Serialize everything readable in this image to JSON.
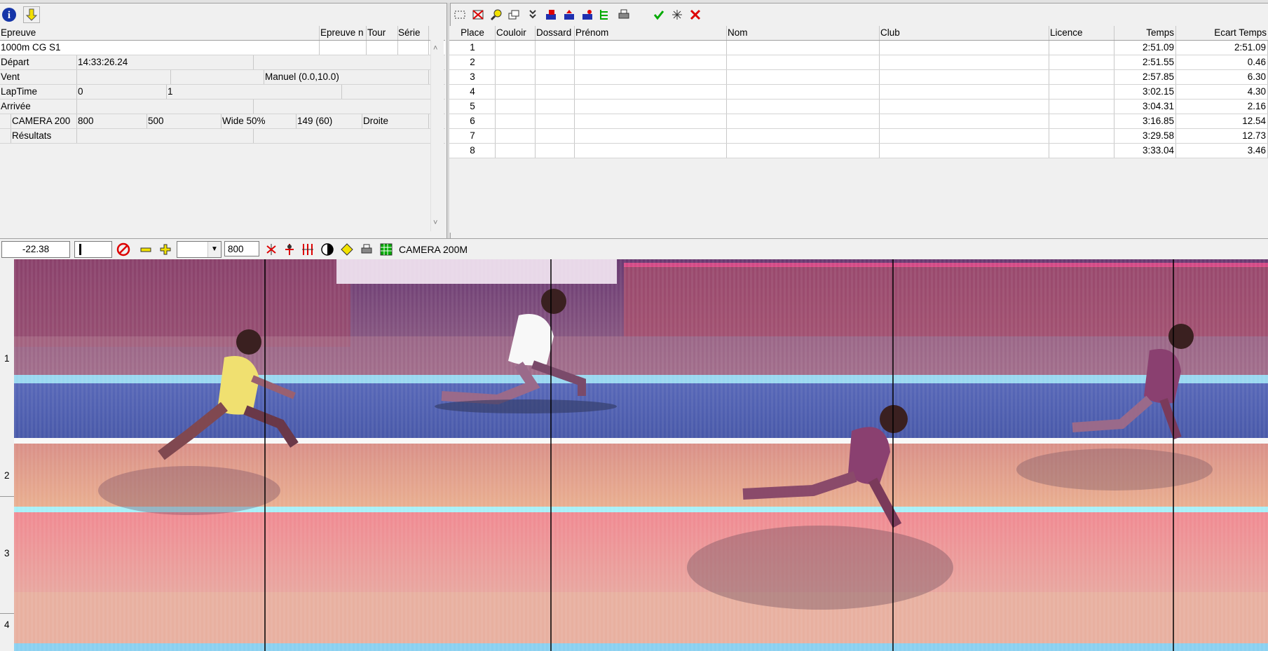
{
  "left_panel": {
    "headers": [
      "Epreuve",
      "Epreuve n",
      "Tour",
      "Série"
    ],
    "event_name": "1000m CG S1",
    "depart_label": "Départ",
    "depart_time": "14:33:26.24",
    "vent_label": "Vent",
    "vent_value": "Manuel (0.0,10.0)",
    "laptime_label": "LapTime",
    "laptime_a": "0",
    "laptime_b": "1",
    "arrivee_label": "Arrivée",
    "camera": {
      "name": "CAMERA 200",
      "v1": "800",
      "v2": "500",
      "wide": "Wide 50%",
      "v3": "149  (60)",
      "side": "Droite"
    },
    "resultats_label": "Résultats"
  },
  "results": {
    "headers": [
      "Place",
      "Couloir",
      "Dossard",
      "Prénom",
      "Nom",
      "Club",
      "Licence",
      "Temps",
      "Ecart Temps"
    ],
    "rows": [
      {
        "place": "1",
        "temps": "2:51.09",
        "ecart": "2:51.09"
      },
      {
        "place": "2",
        "temps": "2:51.55",
        "ecart": "0.46"
      },
      {
        "place": "3",
        "temps": "2:57.85",
        "ecart": "6.30"
      },
      {
        "place": "4",
        "temps": "3:02.15",
        "ecart": "4.30"
      },
      {
        "place": "5",
        "temps": "3:04.31",
        "ecart": "2.16"
      },
      {
        "place": "6",
        "temps": "3:16.85",
        "ecart": "12.54"
      },
      {
        "place": "7",
        "temps": "3:29.58",
        "ecart": "12.73"
      },
      {
        "place": "8",
        "temps": "3:33.04",
        "ecart": "3.46"
      }
    ]
  },
  "photo_toolbar": {
    "offset": "-22.38",
    "zoom_value": "800",
    "camera_label": "CAMERA 200M"
  },
  "lane_labels": [
    "1",
    "2",
    "3",
    "4"
  ],
  "toolbar_icons": [
    "select-icon",
    "clear-icon",
    "zoom-icon",
    "windows-icon",
    "check-list-icon",
    "import-icon",
    "export-icon",
    "send-icon",
    "tree-icon",
    "print-icon",
    "validate-icon",
    "scatter-icon",
    "cancel-icon"
  ]
}
